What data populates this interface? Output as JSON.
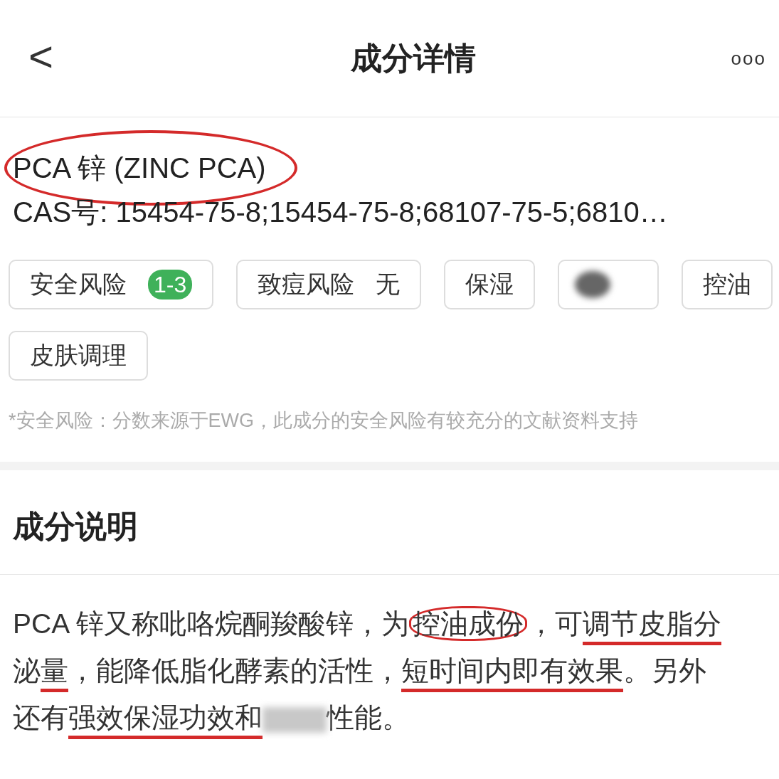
{
  "header": {
    "back": "<",
    "title": "成分详情",
    "more": "ooo"
  },
  "ingredient": {
    "name": "PCA 锌 (ZINC PCA)",
    "name_circled": true,
    "cas": "CAS号: 15454-75-8;15454-75-8;68107-75-5;6810…"
  },
  "tags": [
    {
      "kind": "risk",
      "label": "安全风险",
      "badge": "1-3",
      "color": "#3fb15a"
    },
    {
      "kind": "value",
      "label": "致痘风险",
      "value": "无"
    },
    {
      "kind": "plain",
      "label": "保湿"
    },
    {
      "kind": "blurred"
    },
    {
      "kind": "plain",
      "label": "控油"
    },
    {
      "kind": "plain",
      "label": "皮肤调理"
    }
  ],
  "note": "*安全风险：分数来源于EWG，此成分的安全风险有较充分的文献资料支持",
  "section": {
    "title": "成分说明",
    "segments": [
      {
        "kind": "text",
        "text": "PCA 锌又称吡咯烷酮羧酸锌，为",
        "circled": false,
        "underlined": false
      },
      {
        "kind": "text",
        "text": "控油成份",
        "circled": true,
        "underlined": false
      },
      {
        "kind": "text",
        "text": "，可",
        "circled": false,
        "underlined": false
      },
      {
        "kind": "text",
        "text": "调节皮脂分",
        "circled": false,
        "underlined": true
      },
      {
        "kind": "text",
        "text": "泌",
        "circled": false,
        "underlined": false
      },
      {
        "kind": "text",
        "text": "量",
        "circled": false,
        "underlined": true
      },
      {
        "kind": "text",
        "text": "，能降低脂化酵素的活性，",
        "circled": false,
        "underlined": false
      },
      {
        "kind": "text",
        "text": "短时间内即有效果",
        "circled": false,
        "underlined": true
      },
      {
        "kind": "text",
        "text": "。另外还有",
        "circled": false,
        "underlined": false
      },
      {
        "kind": "text",
        "text": "强效保湿功效和",
        "circled": false,
        "underlined": true
      },
      {
        "kind": "blur"
      },
      {
        "kind": "text",
        "text": "性能。",
        "circled": false,
        "underlined": false
      }
    ]
  }
}
